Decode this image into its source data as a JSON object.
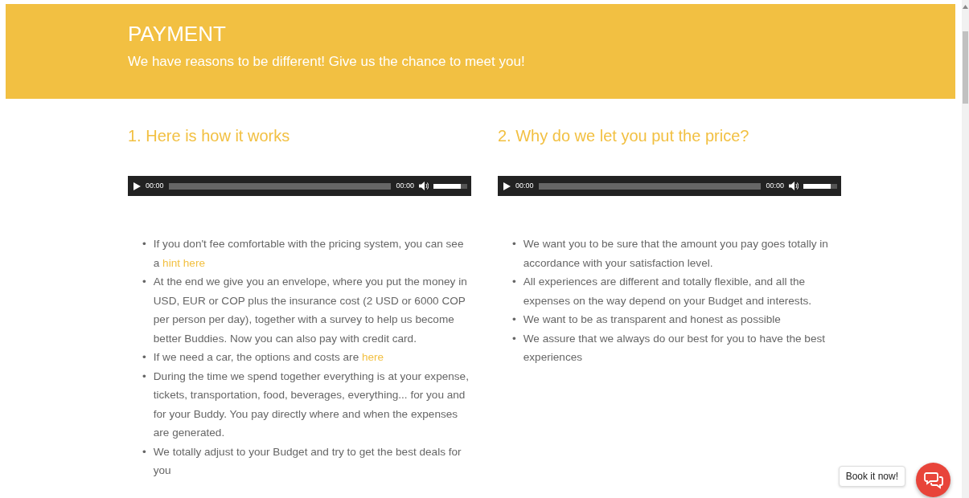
{
  "header": {
    "title": "PAYMENT",
    "subtitle": "We have reasons to be different! Give us the chance to meet you!"
  },
  "columns": [
    {
      "heading": "1. Here is how it works",
      "player": {
        "elapsed": "00:00",
        "duration": "00:00",
        "volume": {
          "level": 0.8
        }
      },
      "items": [
        {
          "bullet": "•",
          "segments": [
            {
              "kind": "text",
              "text": "If you don't fee comfortable with the pricing system, you can see a "
            },
            {
              "kind": "link",
              "text": "hint here"
            }
          ]
        },
        {
          "bullet": "•",
          "segments": [
            {
              "kind": "text",
              "text": "At the end we give you an envelope, where you put the money in USD, EUR or COP plus the insurance cost (2 USD or 6000 COP per person per day), together with a survey to help us become better Buddies. Now you can also pay with credit card."
            }
          ]
        },
        {
          "bullet": "•",
          "segments": [
            {
              "kind": "text",
              "text": "If we need a car, the options and costs are "
            },
            {
              "kind": "link",
              "text": "here"
            }
          ]
        },
        {
          "bullet": "•",
          "segments": [
            {
              "kind": "text",
              "text": "During the time we spend together everything is at your expense, tickets, transportation, food, beverages, everything... for you and for your Buddy.  You pay directly where and when the expenses are generated."
            }
          ]
        },
        {
          "bullet": "•",
          "segments": [
            {
              "kind": "text",
              "text": "We totally adjust to your Budget and try to get the best deals for you"
            }
          ]
        }
      ]
    },
    {
      "heading": "2. Why do we let you put the price?",
      "player": {
        "elapsed": "00:00",
        "duration": "00:00",
        "volume": {
          "level": 0.8
        }
      },
      "items": [
        {
          "bullet": "•",
          "segments": [
            {
              "kind": "text",
              "text": "We want you to be sure that the amount you pay goes totally in accordance with your satisfaction level."
            }
          ]
        },
        {
          "bullet": "•",
          "segments": [
            {
              "kind": "text",
              "text": "All experiences are different and totally flexible, and all the expenses on the way depend on your Budget and interests."
            }
          ]
        },
        {
          "bullet": "•",
          "segments": [
            {
              "kind": "text",
              "text": "We want to be as transparent and honest as possible"
            }
          ]
        },
        {
          "bullet": "•",
          "segments": [
            {
              "kind": "text",
              "text": "We assure that we always do our best for you to have the best experiences"
            }
          ]
        }
      ]
    }
  ],
  "chat": {
    "tooltip": "Book it now!"
  }
}
